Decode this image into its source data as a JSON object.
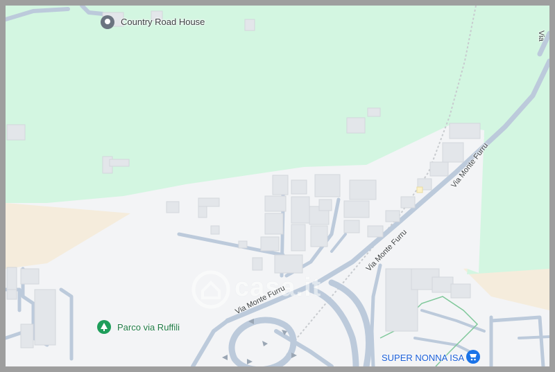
{
  "map": {
    "colors": {
      "park": "#d3f6e1",
      "sand": "#f5ecdc",
      "land": "#f3f4f6",
      "road": "#bccadb",
      "building": "#e3e6ea",
      "railway": "#c8cbcf"
    },
    "pois": {
      "country_road_house": {
        "label": "Country Road House",
        "icon": "map-pin-icon"
      },
      "parco_via_ruffili": {
        "label": "Parco via Ruffili",
        "icon": "tree-icon"
      },
      "super_nonna_isa": {
        "label": "SUPER NONNA ISA",
        "icon": "shopping-cart-icon"
      }
    },
    "roads": {
      "via_monte_furru_1": "Via Monte Furru",
      "via_monte_furru_2": "Via Monte Furru",
      "via_monte_furru_3": "Via Monte Furru",
      "edge_label": "Via"
    },
    "watermark": {
      "text": "casa.it",
      "icon": "house-logo-icon"
    }
  }
}
